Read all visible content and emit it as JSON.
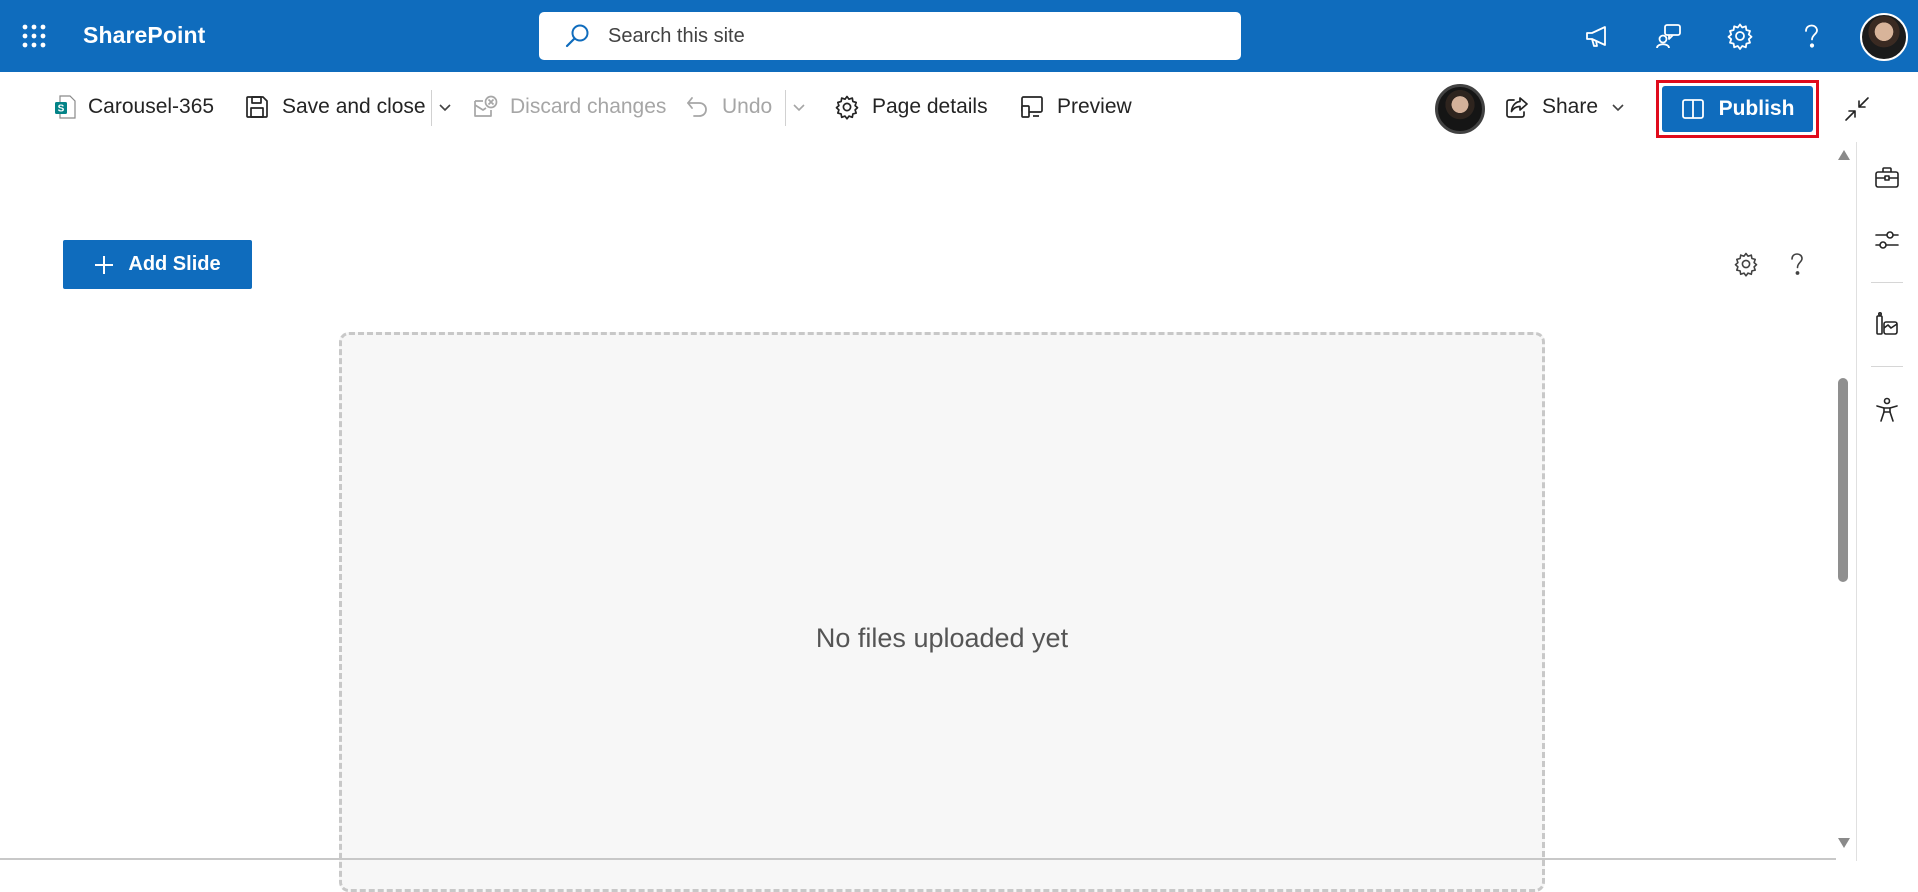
{
  "suite_bar": {
    "app_name": "SharePoint",
    "search_placeholder": "Search this site",
    "icons": [
      "app-launcher-icon",
      "megaphone-icon",
      "chat-feedback-icon",
      "settings-gear-icon",
      "help-icon",
      "user-avatar"
    ],
    "background_color": "#0f6cbd"
  },
  "command_bar": {
    "page_name": "Carousel-365",
    "save_label": "Save and close",
    "discard_label": "Discard changes",
    "undo_label": "Undo",
    "page_details_label": "Page details",
    "preview_label": "Preview",
    "share_label": "Share",
    "publish_label": "Publish",
    "publish_highlight_color": "#e00b1c",
    "disabled_items": [
      "Discard changes",
      "Undo"
    ]
  },
  "canvas": {
    "add_slide_label": "Add Slide",
    "empty_message": "No files uploaded yet"
  },
  "right_rail": {
    "icons": [
      "toolbox-icon",
      "settings-sliders-icon",
      "design-ideas-icon",
      "accessibility-icon"
    ]
  }
}
